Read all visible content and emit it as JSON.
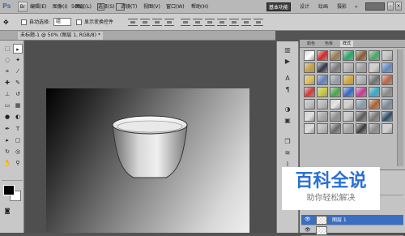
{
  "app": {
    "logo": "Ps"
  },
  "menubar": {
    "items": [
      "编辑(E)",
      "图像(I)",
      "图层(L)",
      "选择(S)",
      "滤镜(T)",
      "视图(V)",
      "窗口(W)",
      "帮助(H)"
    ],
    "zoom": "50%",
    "workspace_buttons": [
      "基本功能",
      "设计",
      "绘画",
      "摄影"
    ]
  },
  "options": {
    "tool_icon": "move-tool",
    "auto_select_label": "自动选择:",
    "auto_select_value": "组",
    "show_transform_label": "显示变换控件"
  },
  "document": {
    "tab_title": "未标题-1 @ 50% (图层 1, RGB/8) *"
  },
  "styles_panel": {
    "tabs": [
      "颜色",
      "色板",
      "样式"
    ],
    "active_tab": "样式",
    "swatches": [
      "#ffffff",
      "#d22",
      "#9a7a4a",
      "#2a6",
      "#8a5a2a",
      "#4a6",
      "#c4c4c4",
      "#c9a23a",
      "#334",
      "#7a7a7a",
      "#b4b4b4",
      "#a0a0a0",
      "#cfcfcf",
      "#5a8acc",
      "#e0c050",
      "#6080c0",
      "#9aa0a8",
      "#d8a830",
      "#b0b0b0",
      "#707070",
      "#c06040",
      "#dd3333",
      "#cccc33",
      "#44aa44",
      "#3366cc",
      "#cc3399",
      "#33aacc",
      "#888888",
      "#c0c0c0",
      "#b8b8b8",
      "#e6e6e6",
      "#cfcfcf",
      "#8a9aaa",
      "#b06030",
      "#7a8a9a",
      "#e0e0e0",
      "#a8a8a8",
      "#909090",
      "#c8c8c8",
      "#5a5a5a",
      "#777777",
      "#2a4a6a",
      "#dcdcdc",
      "#bababa",
      "#6a6a6a",
      "#a4a4a4",
      "#3a3a3a",
      "#8c8c8c",
      "#d0d0d0"
    ]
  },
  "layers": {
    "rows": [
      {
        "name": "",
        "selected": false
      },
      {
        "name": "图层 1",
        "selected": true
      },
      {
        "name": "",
        "selected": false
      }
    ]
  },
  "watermark": {
    "title": "百科全说",
    "subtitle": "助你轻松解决"
  }
}
